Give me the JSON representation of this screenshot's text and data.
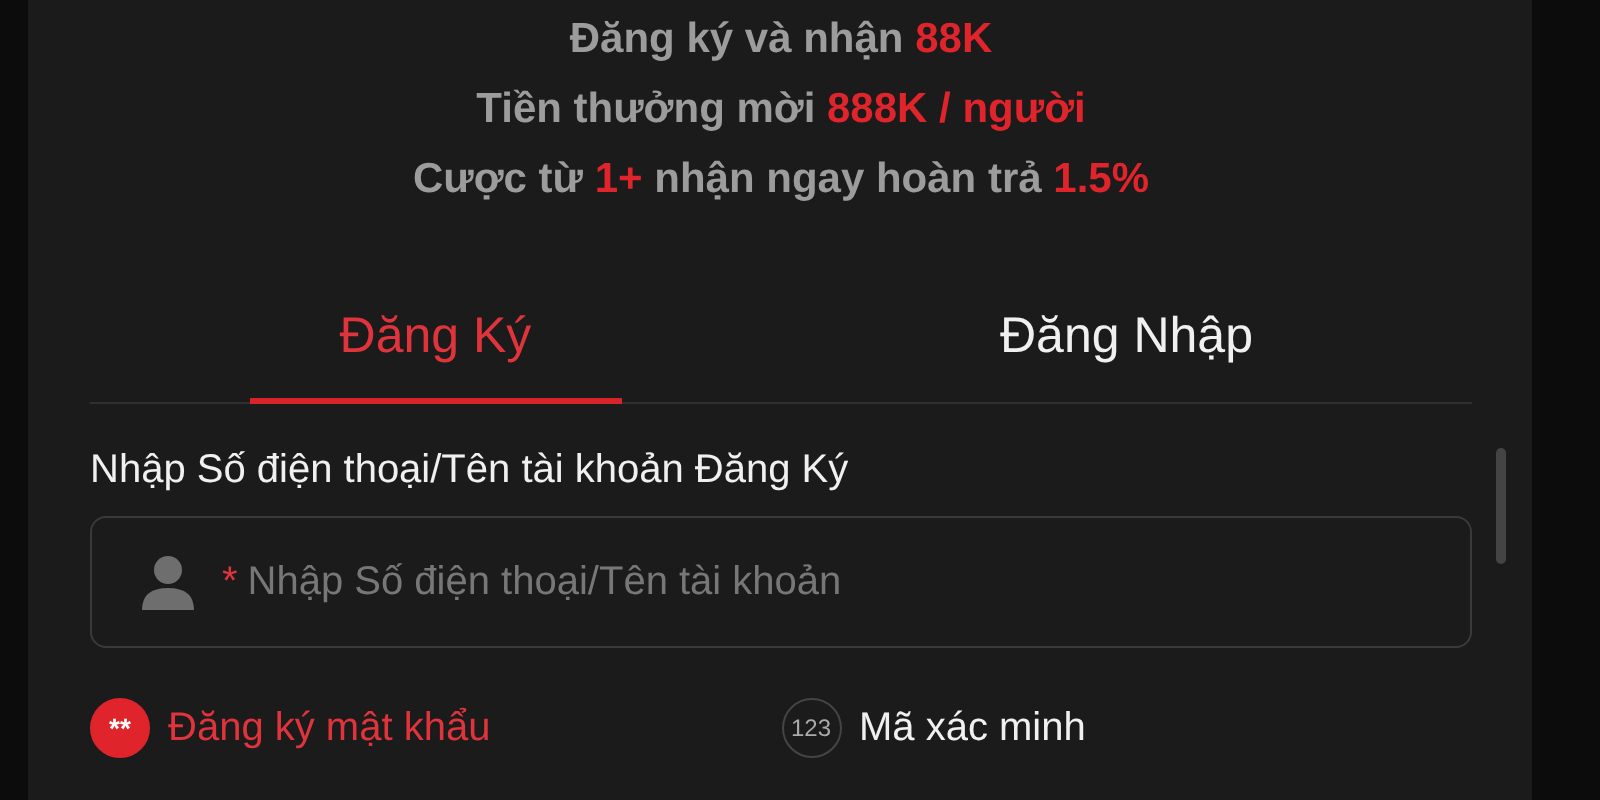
{
  "promo_lines": [
    [
      {
        "text": "Đăng ký và nhận ",
        "highlight": false
      },
      {
        "text": "88K",
        "highlight": true
      }
    ],
    [
      {
        "text": "Tiền thưởng mời ",
        "highlight": false
      },
      {
        "text": "888K / người",
        "highlight": true
      }
    ],
    [
      {
        "text": "Cược từ ",
        "highlight": false
      },
      {
        "text": "1+",
        "highlight": true
      },
      {
        "text": " nhận ngay hoàn trả ",
        "highlight": false
      },
      {
        "text": "1.5%",
        "highlight": true
      }
    ]
  ],
  "tabs": [
    {
      "label": "Đăng Ký",
      "selected": true
    },
    {
      "label": "Đăng Nhập",
      "selected": false
    }
  ],
  "account_field": {
    "label": "Nhập Số điện thoại/Tên tài khoản Đăng Ký",
    "required_mark": "*",
    "placeholder": "Nhập Số điện thoại/Tên tài khoản"
  },
  "methods": [
    {
      "icon_text": "**",
      "label": "Đăng ký mật khẩu",
      "selected": true
    },
    {
      "icon_text": "123",
      "label": "Mã xác minh",
      "selected": false
    }
  ]
}
